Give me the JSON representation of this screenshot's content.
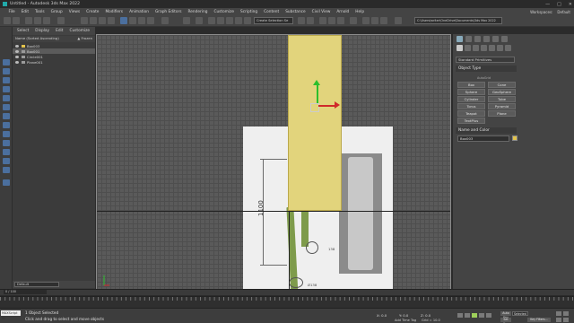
{
  "window": {
    "title": "Untitled - Autodesk 3ds Max 2022",
    "controls": [
      "—",
      "□",
      "✕"
    ]
  },
  "menu": [
    "File",
    "Edit",
    "Tools",
    "Group",
    "Views",
    "Create",
    "Modifiers",
    "Animation",
    "Graph Editors",
    "Rendering",
    "Customize",
    "Scripting",
    "Content",
    "Substance",
    "Civil View",
    "Arnold",
    "Help"
  ],
  "workspace": {
    "label": "Workspaces:",
    "value": "Default"
  },
  "toolbar": {
    "selection_set": "Create Selection Se",
    "project_path": "C:\\Users\\writer\\OneDrive\\Documents\\3ds Max 2022"
  },
  "explorer": {
    "tabs": [
      "Select",
      "Display",
      "Edit",
      "Customize"
    ],
    "header_left": "Name (Sorted Ascending)",
    "header_right": "▲ Frozen",
    "rows": [
      "Box003",
      "Box001",
      "Circle001",
      "Plane001"
    ],
    "layer": "Default"
  },
  "viewport": {
    "label": "[+] [Front] [Standard] [Default Shading]",
    "dimension_text": "1100",
    "label_138a": "138",
    "label_138b": "Ø138"
  },
  "command_panel": {
    "category": "Standard Primitives",
    "object_type_title": "Object Type",
    "autogrid": "AutoGrid",
    "buttons": [
      "Box",
      "Cone",
      "Sphere",
      "GeoSphere",
      "Cylinder",
      "Tube",
      "Torus",
      "Pyramid",
      "Teapot",
      "Plane",
      "TextPlus"
    ],
    "name_color_title": "Name and Color",
    "object_name": "Box003",
    "object_color": "#e2c34c"
  },
  "timeline": {
    "frame_counter": "0 / 100"
  },
  "status": {
    "maxscript": "MAXScript Mi",
    "line1": "1 Object Selected",
    "line2": "Click and drag to select and move objects",
    "x": "X: 0.0",
    "y": "Y: 0.0",
    "z": "Z: 0.0",
    "grid": "Grid = 10.0",
    "time_tag": "Add Time Tag",
    "auto_key": "Auto Key",
    "set_key": "Set Key",
    "selected": "Selected",
    "key_filters": "Key Filters..."
  },
  "colors": {
    "accent_blue": "#4b6f9e",
    "plate_yellow": "#e2d47c",
    "tube_green": "#7e9b4b",
    "gizmo_x": "#d02a2a",
    "gizmo_y": "#2cbf2c"
  }
}
